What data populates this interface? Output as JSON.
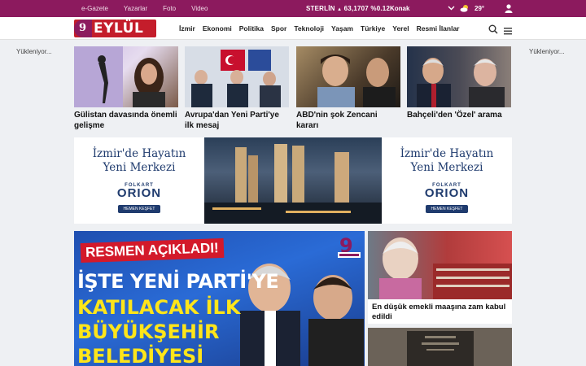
{
  "topbar": {
    "links": [
      "e-Gazete",
      "Yazarlar",
      "Foto",
      "Video"
    ],
    "currency": "STERLİN",
    "rate": "63,1707",
    "change": "%0.12",
    "city": "Konak",
    "temperature": "29°",
    "colors": {
      "bar": "#8c1a5e"
    }
  },
  "logo": {
    "text": "EYLÜL"
  },
  "menu": [
    "İzmir",
    "Ekonomi",
    "Politika",
    "Spor",
    "Teknoloji",
    "Yaşam",
    "Türkiye",
    "Yerel",
    "Resmi İlanlar"
  ],
  "loading_left": "Yükleniyor...",
  "loading_right": "Yükleniyor...",
  "cards": [
    {
      "title": "Gülistan davasında önemli gelişme"
    },
    {
      "title": "Avrupa'dan Yeni Parti'ye ilk mesaj"
    },
    {
      "title": "ABD'nin şok Zencani kararı"
    },
    {
      "title": "Bahçeli'den 'Özel' arama"
    }
  ],
  "ad": {
    "headline_line1": "İzmir'de Hayatın",
    "headline_line2": "Yeni Merkezi",
    "brand_top": "FOLKART",
    "brand_main": "ORION",
    "cta": "HEMEN KEŞFET"
  },
  "hero": {
    "tag": "RESMEN AÇIKLADI!",
    "line1": "İŞTE YENİ PARTİ'YE",
    "line2": "KATILACAK İLK",
    "line3": "BÜYÜKŞEHİR",
    "line4": "BELEDİYESİ"
  },
  "side_story": {
    "title": "En düşük emekli maaşına zam kabul edildi"
  }
}
